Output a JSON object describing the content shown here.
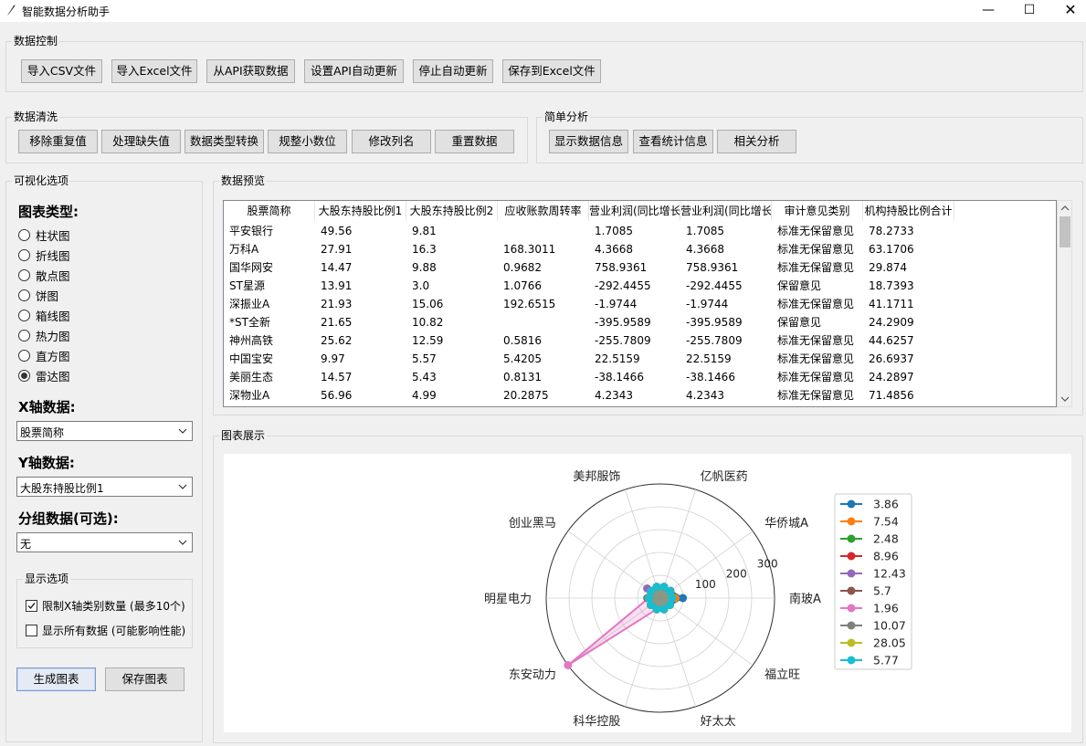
{
  "window": {
    "title": "智能数据分析助手",
    "controls": [
      "—",
      "☐",
      "✕"
    ]
  },
  "data_control": {
    "label": "数据控制",
    "buttons": [
      "导入CSV文件",
      "导入Excel文件",
      "从API获取数据",
      "设置API自动更新",
      "停止自动更新",
      "保存到Excel文件"
    ]
  },
  "data_cleaning": {
    "label": "数据清洗",
    "buttons": [
      "移除重复值",
      "处理缺失值",
      "数据类型转换",
      "规整小数位",
      "修改列名",
      "重置数据"
    ]
  },
  "simple_analysis": {
    "label": "简单分析",
    "buttons": [
      "显示数据信息",
      "查看统计信息",
      "相关分析"
    ]
  },
  "viz_options": {
    "label": "可视化选项",
    "chart_type_title": "图表类型:",
    "chart_types": [
      "柱状图",
      "折线图",
      "散点图",
      "饼图",
      "箱线图",
      "热力图",
      "直方图",
      "雷达图"
    ],
    "selected_chart_type": "雷达图",
    "x_axis_title": "X轴数据:",
    "x_axis_value": "股票简称",
    "y_axis_title": "Y轴数据:",
    "y_axis_value": "大股东持股比例1",
    "group_title": "分组数据(可选):",
    "group_value": "无",
    "display_options": {
      "label": "显示选项",
      "limit_x": {
        "label": "限制X轴类别数量 (最多10个)",
        "checked": true
      },
      "show_all": {
        "label": "显示所有数据 (可能影响性能)",
        "checked": false
      }
    },
    "generate_button": "生成图表",
    "save_button": "保存图表"
  },
  "data_preview": {
    "label": "数据预览",
    "columns": [
      "股票简称",
      "大股东持股比例1",
      "大股东持股比例2",
      "应收账款周转率",
      "营业利润(同比增长",
      "营业利润(同比增长",
      "审计意见类别",
      "机构持股比例合计"
    ],
    "rows": [
      [
        "平安银行",
        "49.56",
        "9.81",
        "",
        "1.7085",
        "1.7085",
        "标准无保留意见",
        "78.2733"
      ],
      [
        "万科A",
        "27.91",
        "16.3",
        "168.3011",
        "4.3668",
        "4.3668",
        "标准无保留意见",
        "63.1706"
      ],
      [
        "国华网安",
        "14.47",
        "9.88",
        "0.9682",
        "758.9361",
        "758.9361",
        "标准无保留意见",
        "29.874"
      ],
      [
        "ST星源",
        "13.91",
        "3.0",
        "1.0766",
        "-292.4455",
        "-292.4455",
        "保留意见",
        "18.7393"
      ],
      [
        "深振业A",
        "21.93",
        "15.06",
        "192.6515",
        "-1.9744",
        "-1.9744",
        "标准无保留意见",
        "41.1711"
      ],
      [
        "*ST全新",
        "21.65",
        "10.82",
        "",
        "-395.9589",
        "-395.9589",
        "保留意见",
        "24.2909"
      ],
      [
        "神州高铁",
        "25.62",
        "12.59",
        "0.5816",
        "-255.7809",
        "-255.7809",
        "标准无保留意见",
        "44.6257"
      ],
      [
        "中国宝安",
        "9.97",
        "5.57",
        "5.4205",
        "22.5159",
        "22.5159",
        "标准无保留意见",
        "26.6937"
      ],
      [
        "美丽生态",
        "14.57",
        "5.43",
        "0.8131",
        "-38.1466",
        "-38.1466",
        "标准无保留意见",
        "24.2897"
      ],
      [
        "深物业A",
        "56.96",
        "4.99",
        "20.2875",
        "4.2343",
        "4.2343",
        "标准无保留意见",
        "71.4856"
      ]
    ]
  },
  "chart_panel": {
    "label": "图表展示"
  },
  "chart_data": {
    "type": "radar",
    "categories": [
      "南玻A",
      "华侨城A",
      "亿帆医药",
      "美邦服饰",
      "创业黑马",
      "明星电力",
      "东安动力",
      "科华控股",
      "好太太",
      "福立旺"
    ],
    "rticks": [
      100,
      200,
      300
    ],
    "rmax": 350,
    "grid": true,
    "legend_position": "right",
    "series": [
      {
        "name": "3.86",
        "color": "#1f77b4",
        "values": [
          69,
          38,
          36,
          36,
          36,
          36,
          36,
          36,
          36,
          36
        ]
      },
      {
        "name": "7.54",
        "color": "#ff7f0e",
        "values": [
          46,
          36,
          36,
          36,
          36,
          36,
          36,
          36,
          36,
          36
        ]
      },
      {
        "name": "2.48",
        "color": "#2ca02c",
        "values": [
          36,
          36,
          36,
          36,
          36,
          36,
          36,
          36,
          36,
          36
        ]
      },
      {
        "name": "8.96",
        "color": "#d62728",
        "values": [
          36,
          36,
          36,
          36,
          36,
          36,
          36,
          36,
          36,
          36
        ]
      },
      {
        "name": "12.43",
        "color": "#9467bd",
        "values": [
          36,
          36,
          36,
          36,
          50,
          36,
          36,
          36,
          36,
          36
        ]
      },
      {
        "name": "5.7",
        "color": "#8c564b",
        "values": [
          36,
          36,
          36,
          36,
          36,
          40,
          36,
          36,
          36,
          36
        ]
      },
      {
        "name": "1.96",
        "color": "#e377c2",
        "values": [
          36,
          36,
          36,
          36,
          36,
          36,
          350,
          36,
          36,
          36
        ]
      },
      {
        "name": "10.07",
        "color": "#7f7f7f",
        "values": [
          36,
          36,
          36,
          36,
          36,
          36,
          36,
          36,
          36,
          36
        ]
      },
      {
        "name": "28.05",
        "color": "#bcbd22",
        "values": [
          36,
          36,
          36,
          36,
          36,
          36,
          36,
          36,
          36,
          36
        ]
      },
      {
        "name": "5.77",
        "color": "#17becf",
        "values": [
          36,
          36,
          36,
          36,
          36,
          36,
          36,
          36,
          36,
          36
        ]
      }
    ]
  }
}
